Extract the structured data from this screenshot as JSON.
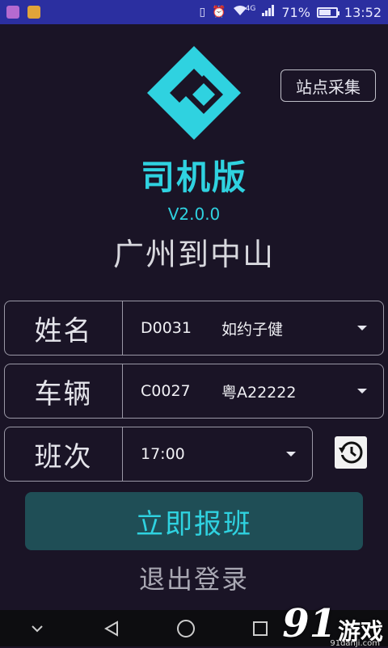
{
  "status_bar": {
    "signal_label": "4G",
    "battery_percent": "71%",
    "battery_level": 0.71,
    "time": "13:52",
    "icons": [
      "vibrate-icon",
      "alarm-icon",
      "wifi-icon",
      "signal-icon",
      "battery-icon"
    ]
  },
  "header": {
    "collect_button": "站点采集",
    "title": "司机版",
    "version": "V2.0.0",
    "route": "广州到中山"
  },
  "form": {
    "name_row": {
      "label": "姓名",
      "code": "D0031",
      "value": "如约子健"
    },
    "vehicle_row": {
      "label": "车辆",
      "code": "C0027",
      "value": "粤A22222"
    },
    "shift_row": {
      "label": "班次",
      "value": "17:00"
    }
  },
  "actions": {
    "report": "立即报班",
    "logout": "退出登录"
  },
  "watermark": {
    "number": "91",
    "text": "游戏",
    "sub": "91danji.com"
  },
  "colors": {
    "accent": "#2fd2e0",
    "status_bar": "#2b2fa0",
    "background": "#1a1426",
    "button_bg": "#1f4e56"
  }
}
